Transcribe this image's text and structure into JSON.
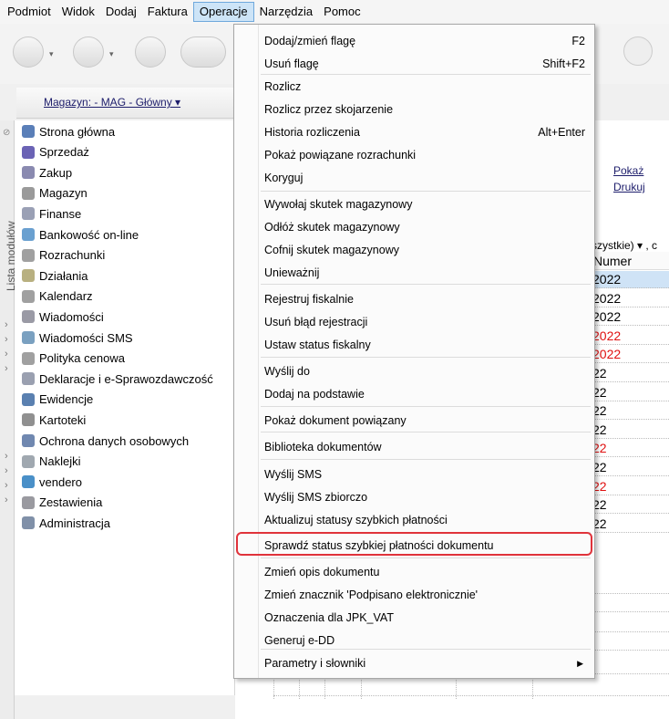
{
  "menubar": {
    "items": [
      "Podmiot",
      "Widok",
      "Dodaj",
      "Faktura",
      "Operacje",
      "Narzędzia",
      "Pomoc"
    ],
    "active": "Operacje"
  },
  "magazyn_label": "Magazyn: - MAG - Główny ▾",
  "side_tab_label": "Lista modułów",
  "modules": [
    {
      "label": "Strona główna",
      "icon": "home-icon",
      "color": "#5a7fb8"
    },
    {
      "label": "Sprzedaż",
      "icon": "sales-icon",
      "color": "#6b63b5"
    },
    {
      "label": "Zakup",
      "icon": "purchase-icon",
      "color": "#8a8ab0"
    },
    {
      "label": "Magazyn",
      "icon": "warehouse-icon",
      "color": "#9a9a9a"
    },
    {
      "label": "Finanse",
      "icon": "finance-icon",
      "color": "#9aa0b5"
    },
    {
      "label": "Bankowość on-line",
      "icon": "bank-icon",
      "color": "#6aa0d0"
    },
    {
      "label": "Rozrachunki",
      "icon": "settlements-icon",
      "color": "#a0a0a0"
    },
    {
      "label": "Działania",
      "icon": "actions-icon",
      "color": "#b8b080"
    },
    {
      "label": "Kalendarz",
      "icon": "calendar-icon",
      "color": "#a0a0a0"
    },
    {
      "label": "Wiadomości",
      "icon": "messages-icon",
      "color": "#9a9aa5"
    },
    {
      "label": "Wiadomości SMS",
      "icon": "sms-icon",
      "color": "#7aa0c0"
    },
    {
      "label": "Polityka cenowa",
      "icon": "pricing-icon",
      "color": "#a0a0a0"
    },
    {
      "label": "Deklaracje i e-Sprawozdawczość",
      "icon": "declarations-icon",
      "color": "#9aa0b0"
    },
    {
      "label": "Ewidencje",
      "icon": "records-icon",
      "color": "#5a80b0"
    },
    {
      "label": "Kartoteki",
      "icon": "cards-icon",
      "color": "#909090"
    },
    {
      "label": "Ochrona danych osobowych",
      "icon": "data-protection-icon",
      "color": "#7088b0"
    },
    {
      "label": "Naklejki",
      "icon": "stickers-icon",
      "color": "#a0a8b0"
    },
    {
      "label": "vendero",
      "icon": "vendero-icon",
      "color": "#4a90c8"
    },
    {
      "label": "Zestawienia",
      "icon": "reports-icon",
      "color": "#9a9aa0"
    },
    {
      "label": "Administracja",
      "icon": "admin-icon",
      "color": "#8090a8"
    }
  ],
  "content": {
    "link_show": "Pokaż",
    "link_print": "Drukuj",
    "filter_text": "szystkie) ▾ , c",
    "column_header": "Numer",
    "rows": [
      {
        "text": "2022",
        "red": false,
        "selected": true
      },
      {
        "text": "2022",
        "red": false,
        "selected": false
      },
      {
        "text": "2022",
        "red": false,
        "selected": false
      },
      {
        "text": "2022",
        "red": true,
        "selected": false
      },
      {
        "text": "2022",
        "red": true,
        "selected": false
      },
      {
        "text": "22",
        "red": false,
        "selected": false
      },
      {
        "text": "22",
        "red": false,
        "selected": false
      },
      {
        "text": "22",
        "red": false,
        "selected": false
      },
      {
        "text": "22",
        "red": false,
        "selected": false
      },
      {
        "text": "22",
        "red": true,
        "selected": false
      },
      {
        "text": "22",
        "red": false,
        "selected": false
      },
      {
        "text": "22",
        "red": true,
        "selected": false
      },
      {
        "text": "22",
        "red": false,
        "selected": false
      },
      {
        "text": "22",
        "red": false,
        "selected": false
      }
    ]
  },
  "dropdown": {
    "items": [
      {
        "label": "Dodaj/zmień flagę",
        "shortcut": "F2"
      },
      {
        "label": "Usuń flagę",
        "shortcut": "Shift+F2"
      },
      {
        "label": "Rozlicz",
        "shortcut": ""
      },
      {
        "label": "Rozlicz przez skojarzenie",
        "shortcut": ""
      },
      {
        "label": "Historia rozliczenia",
        "shortcut": "Alt+Enter"
      },
      {
        "label": "Pokaż powiązane rozrachunki",
        "shortcut": ""
      },
      {
        "label": "Koryguj",
        "shortcut": ""
      },
      {
        "label": "Wywołaj skutek magazynowy",
        "shortcut": ""
      },
      {
        "label": "Odłóż skutek magazynowy",
        "shortcut": ""
      },
      {
        "label": "Cofnij skutek magazynowy",
        "shortcut": ""
      },
      {
        "label": "Unieważnij",
        "shortcut": ""
      },
      {
        "label": "Rejestruj fiskalnie",
        "shortcut": ""
      },
      {
        "label": "Usuń błąd rejestracji",
        "shortcut": ""
      },
      {
        "label": "Ustaw status fiskalny",
        "shortcut": ""
      },
      {
        "label": "Wyślij do",
        "shortcut": ""
      },
      {
        "label": "Dodaj na podstawie",
        "shortcut": ""
      },
      {
        "label": "Pokaż dokument powiązany",
        "shortcut": ""
      },
      {
        "label": "Biblioteka dokumentów",
        "shortcut": ""
      },
      {
        "label": "Wyślij SMS",
        "shortcut": ""
      },
      {
        "label": "Wyślij SMS zbiorczo",
        "shortcut": ""
      },
      {
        "label": "Aktualizuj statusy szybkich płatności",
        "shortcut": ""
      },
      {
        "label": "Sprawdź status szybkiej płatności dokumentu",
        "shortcut": ""
      },
      {
        "label": "Zmień opis dokumentu",
        "shortcut": ""
      },
      {
        "label": "Zmień znacznik 'Podpisano elektronicznie'",
        "shortcut": ""
      },
      {
        "label": "Oznaczenia dla JPK_VAT",
        "shortcut": ""
      },
      {
        "label": "Generuj e-DD",
        "shortcut": ""
      },
      {
        "label": "Parametry i słowniki",
        "shortcut": "▶"
      }
    ],
    "highlighted": "Sprawdź status szybkiej płatności dokumentu",
    "highlight_color": "#e0333b"
  }
}
